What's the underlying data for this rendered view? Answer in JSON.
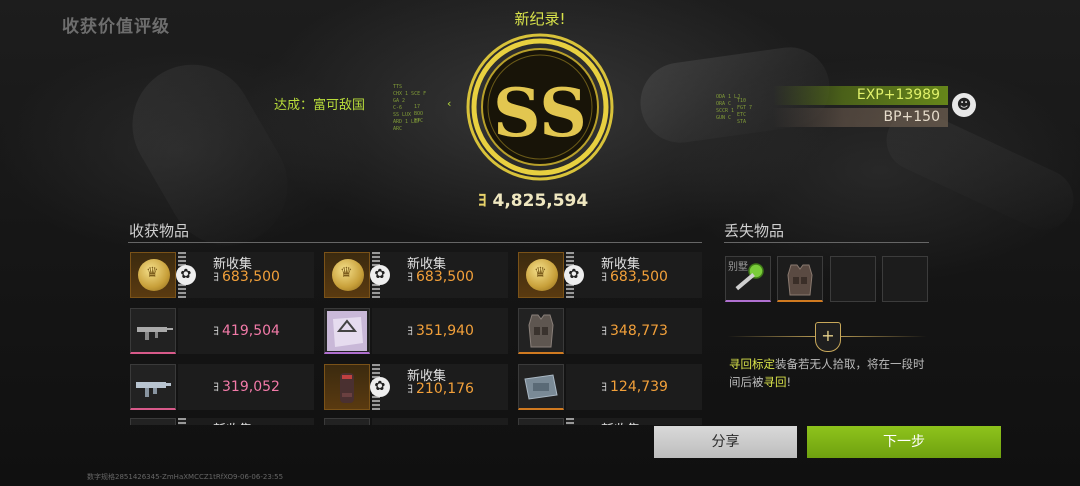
{
  "page_title": "收获价值评级",
  "new_record": "新纪录!",
  "achievement": "达成：富可敌国",
  "grade": "SS",
  "currency_icon": "ha-coin-icon",
  "total_value": "4,825,594",
  "rewards": {
    "exp": "EXP+13989",
    "bp": "BP+150"
  },
  "hud_text": {
    "left_a": [
      "TTS",
      "CHX 1 SCE F",
      "GA 2",
      "C-6",
      "SS LUX",
      "ARD 1 LEF",
      "ARC"
    ],
    "left_b": [
      "17",
      "BOO",
      "ETC"
    ],
    "right_a": [
      "ODA 1 LJ",
      "ORA C",
      "SCCR 1",
      "GUN C"
    ],
    "right_b": [
      "T10",
      "FGT 7",
      "ETC",
      "STA"
    ]
  },
  "collected": {
    "title": "收获物品",
    "new_label": "新收集",
    "items": [
      {
        "value": "683,500",
        "color": "orange",
        "new": true,
        "icon": "gold-coin-icon"
      },
      {
        "value": "683,500",
        "color": "orange",
        "new": true,
        "icon": "gold-coin-icon"
      },
      {
        "value": "683,500",
        "color": "orange",
        "new": true,
        "icon": "gold-coin-icon"
      },
      {
        "value": "419,504",
        "color": "pink",
        "new": false,
        "icon": "rifle-icon"
      },
      {
        "value": "351,940",
        "color": "orange",
        "new": false,
        "icon": "crystal-card-icon"
      },
      {
        "value": "348,773",
        "color": "orange",
        "new": false,
        "icon": "armor-vest-icon"
      },
      {
        "value": "319,052",
        "color": "pink",
        "new": false,
        "icon": "smg-icon"
      },
      {
        "value": "210,176",
        "color": "orange",
        "new": true,
        "icon": "canister-icon"
      },
      {
        "value": "124,739",
        "color": "orange",
        "new": false,
        "icon": "case-icon"
      },
      {
        "value": "",
        "color": "orange",
        "new": true,
        "icon": "item-icon"
      },
      {
        "value": "",
        "color": "orange",
        "new": false,
        "icon": "item-icon"
      },
      {
        "value": "",
        "color": "orange",
        "new": true,
        "icon": "item-icon"
      }
    ]
  },
  "lost": {
    "title": "丢失物品",
    "slot_label": "别墅",
    "items": [
      "green-key-icon",
      "armor-rig-icon",
      "empty-slot",
      "empty-slot"
    ]
  },
  "recover": {
    "icon": "shield-plus-icon",
    "hl1": "寻回标定",
    "text1": "装备若无人拾取，将在一段时间后被",
    "hl2": "寻回",
    "text2": "!"
  },
  "buttons": {
    "share": "分享",
    "next": "下一步"
  },
  "footer": "数字规格2851426345-ZmHaXMCCZ1tRfXO9-06-06-23:55",
  "colors": {
    "accent": "#d9e34a",
    "gold": "#d8b84a",
    "next_button": "#7fb316",
    "value_orange": "#f2a03a",
    "value_pink": "#f27aa8"
  }
}
